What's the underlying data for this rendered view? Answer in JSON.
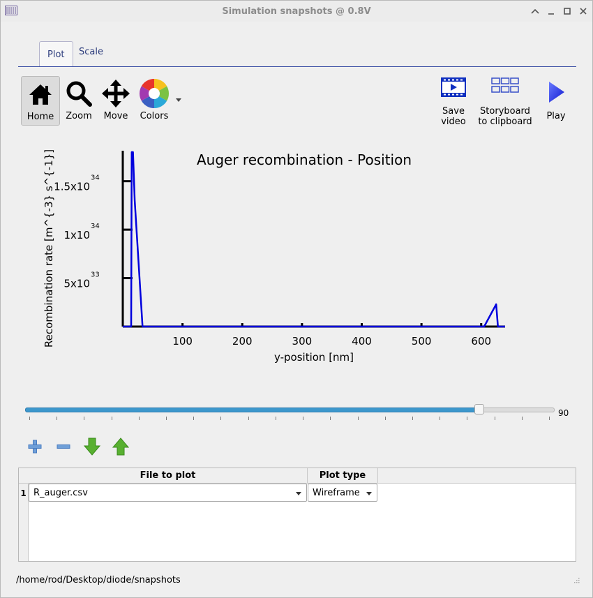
{
  "window": {
    "title": "Simulation snapshots @ 0.8V",
    "controls": [
      "chevron-up-icon",
      "minimize-icon",
      "maximize-icon",
      "close-icon"
    ]
  },
  "tabs": [
    {
      "label": "Plot",
      "active": true
    },
    {
      "label": "Scale",
      "active": false
    }
  ],
  "toolbar": {
    "home": "Home",
    "zoom": "Zoom",
    "move": "Move",
    "colors": "Colors",
    "save_video_1": "Save",
    "save_video_2": "video",
    "storyboard_1": "Storyboard",
    "storyboard_2": "to clipboard",
    "play": "Play"
  },
  "chart_data": {
    "type": "line",
    "title": "Auger recombination - Position",
    "xlabel": "y-position [nm]",
    "ylabel": "Recombination rate [m^{-3} s^{-1}]",
    "xlim": [
      0,
      640
    ],
    "ylim": [
      0,
      1.8e+34
    ],
    "x_ticks": [
      "100",
      "200",
      "300",
      "400",
      "500",
      "600"
    ],
    "y_ticks": [
      {
        "value": 5e+33,
        "mant": "5x10",
        "exp": "33"
      },
      {
        "value": 1e+34,
        "mant": "1x10",
        "exp": "34"
      },
      {
        "value": 1.5e+34,
        "mant": "1.5x10",
        "exp": "34"
      }
    ],
    "series": [
      {
        "color": "#0000dd",
        "x": [
          0,
          14,
          15,
          17,
          20,
          33,
          600,
          605,
          625,
          628,
          640
        ],
        "y": [
          0,
          0,
          1.8e+34,
          1.8e+34,
          1.3e+34,
          0,
          0,
          0,
          2.3e+33,
          0,
          0
        ]
      }
    ]
  },
  "slider": {
    "value": 90,
    "fraction": 0.859,
    "label": "90"
  },
  "table": {
    "headers": [
      "File to plot",
      "Plot type"
    ],
    "rows": [
      {
        "num": "1",
        "file": "R_auger.csv",
        "type": "Wireframe"
      }
    ]
  },
  "status": {
    "path": "/home/rod/Desktop/diode/snapshots"
  }
}
